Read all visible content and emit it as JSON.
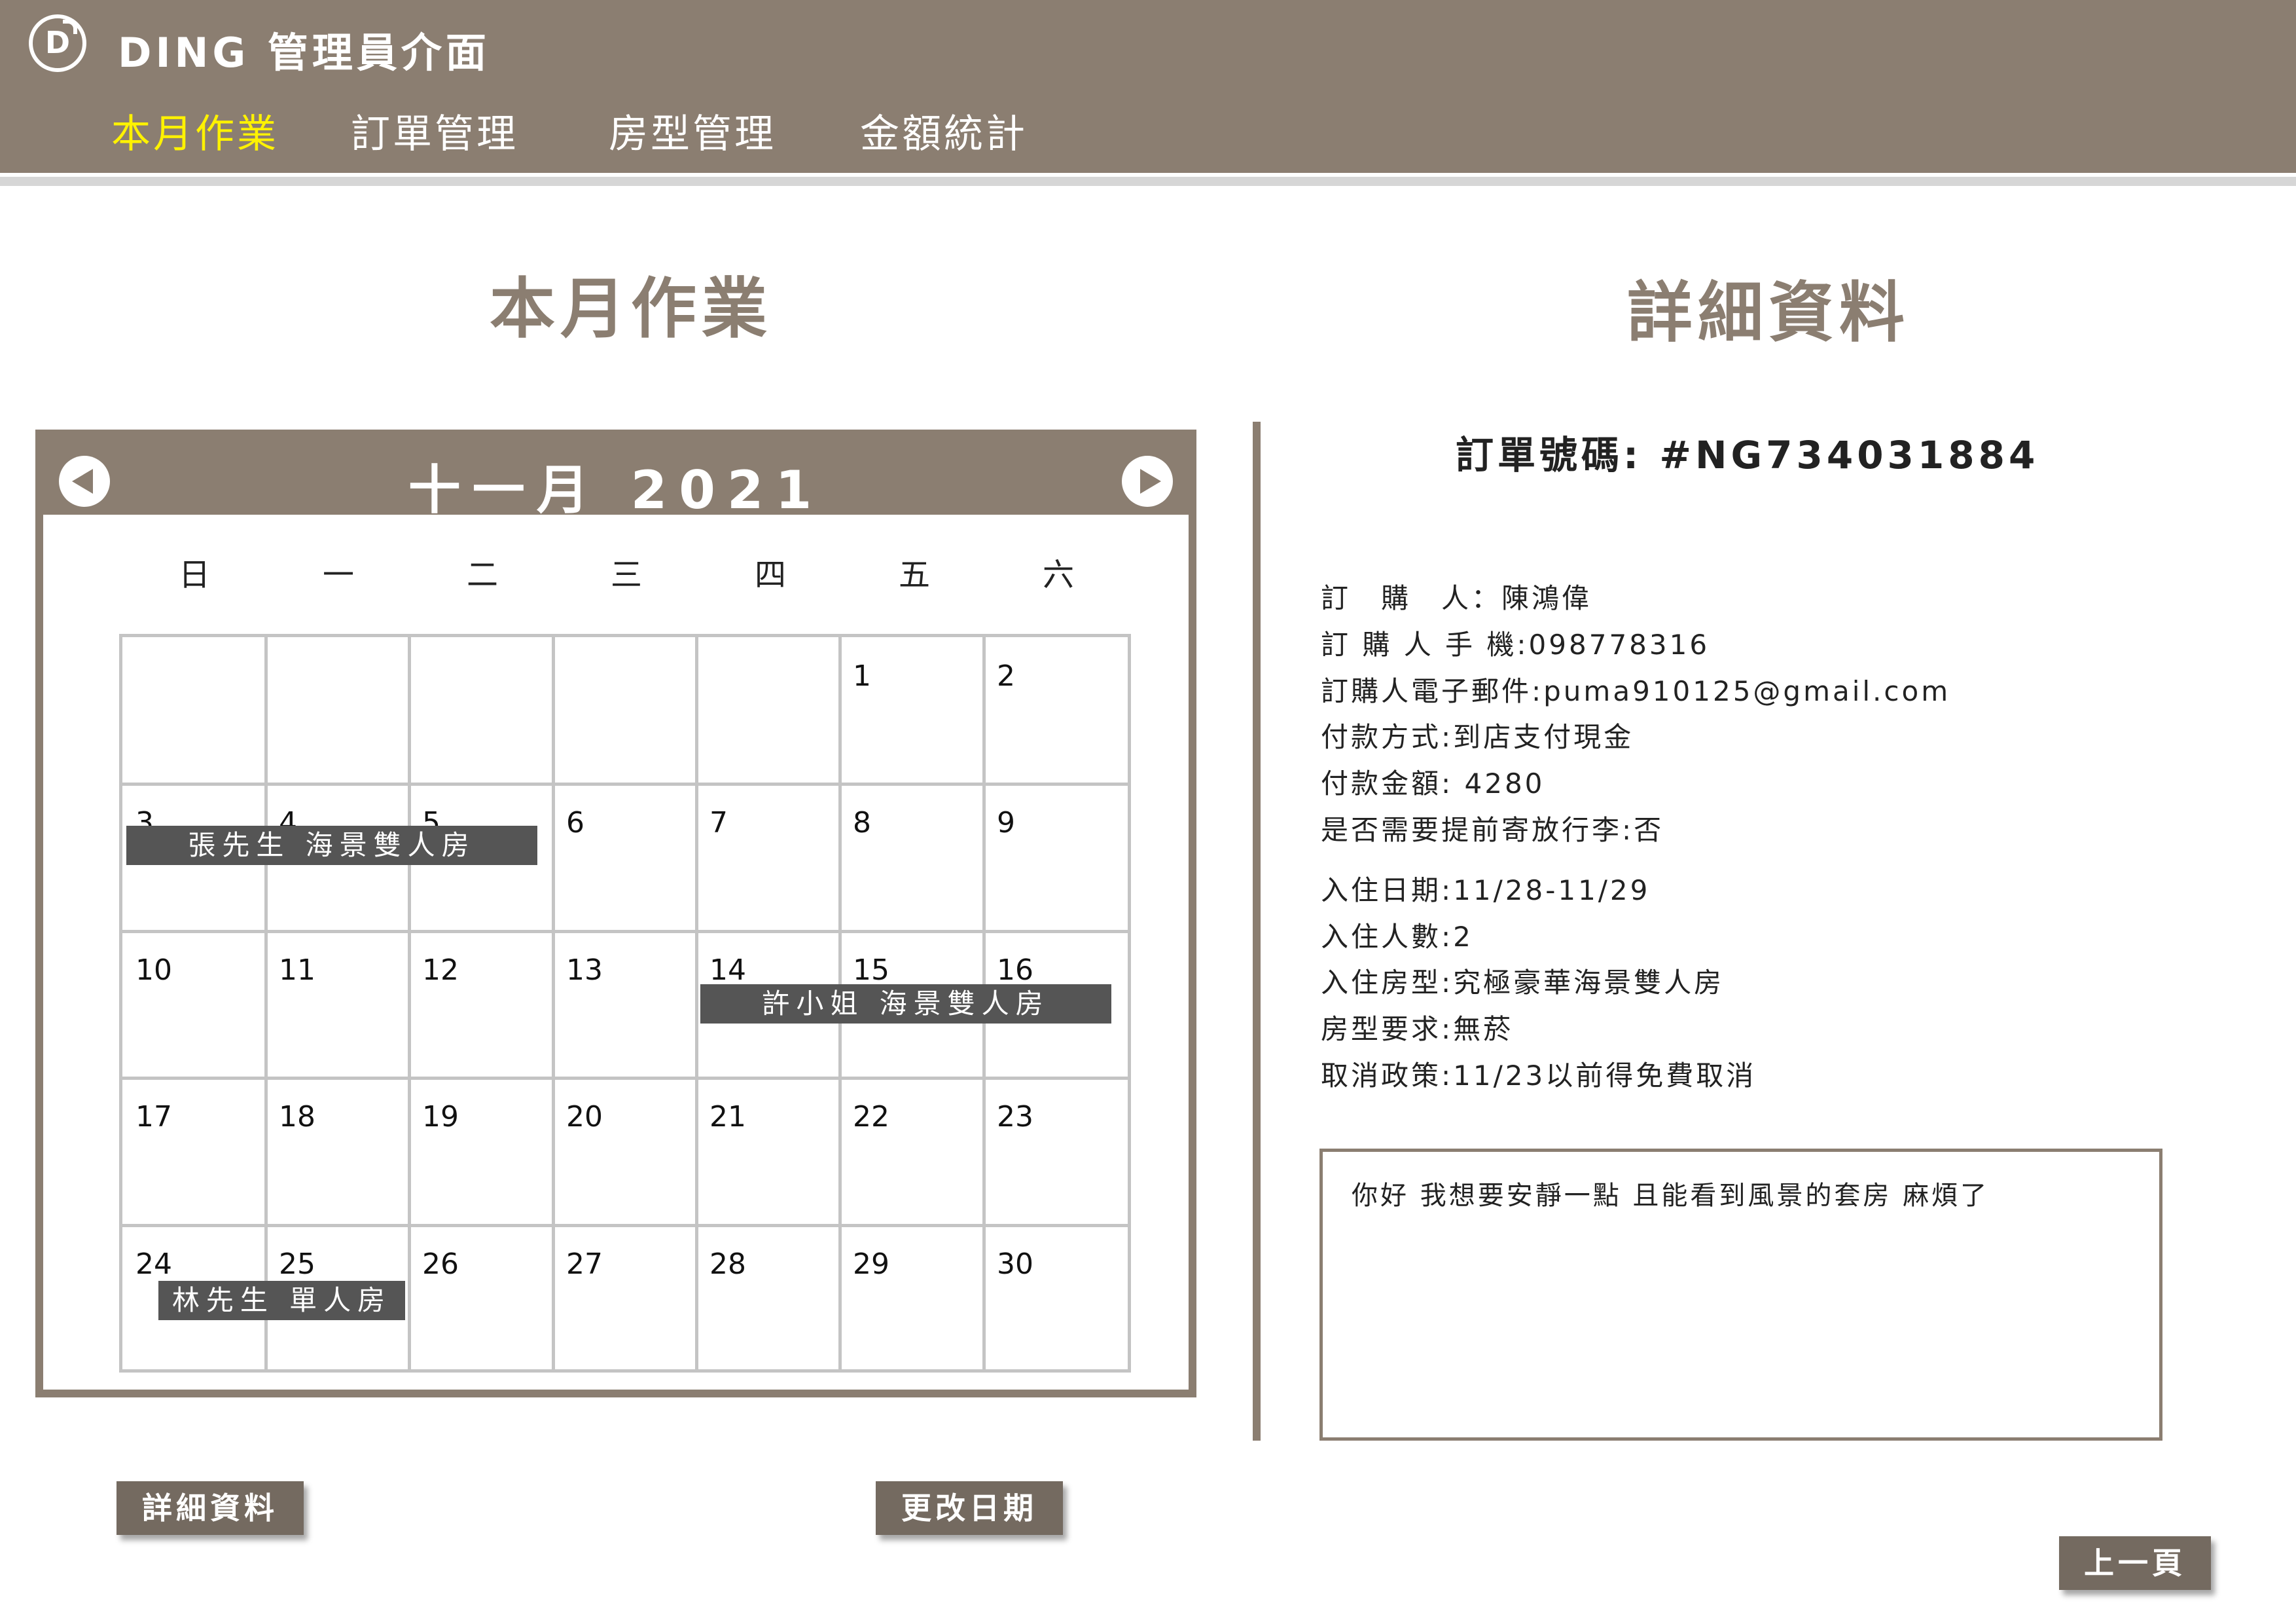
{
  "header": {
    "app_title": "DING 管理員介面",
    "logo_letter": "D",
    "nav": [
      {
        "label": "本月作業",
        "active": true
      },
      {
        "label": "訂單管理",
        "active": false
      },
      {
        "label": "房型管理",
        "active": false
      },
      {
        "label": "金額統計",
        "active": false
      }
    ]
  },
  "left": {
    "section_title": "本月作業",
    "calendar": {
      "month_label": "十一月 2021",
      "weekdays": [
        "日",
        "一",
        "二",
        "三",
        "四",
        "五",
        "六"
      ],
      "weeks": [
        [
          "",
          "",
          "",
          "",
          "",
          "1",
          "2"
        ],
        [
          "3",
          "4",
          "5",
          "6",
          "7",
          "8",
          "9"
        ],
        [
          "10",
          "11",
          "12",
          "13",
          "14",
          "15",
          "16"
        ],
        [
          "17",
          "18",
          "19",
          "20",
          "21",
          "22",
          "23"
        ],
        [
          "24",
          "25",
          "26",
          "27",
          "28",
          "29",
          "30"
        ]
      ],
      "events": [
        {
          "label": "張先生 海景雙人房"
        },
        {
          "label": "許小姐 海景雙人房"
        },
        {
          "label": "林先生 單人房"
        }
      ]
    },
    "buttons": {
      "detail": "詳細資料",
      "change_date": "更改日期"
    }
  },
  "right": {
    "section_title": "詳細資料",
    "order_number": "訂單號碼: #NG734031884",
    "info_lines": [
      "訂　購　人：陳鴻偉",
      "訂 購 人 手 機:098778316",
      "訂購人電子郵件:puma910125@gmail.com",
      "付款方式:到店支付現金",
      "付款金額: 4280",
      "是否需要提前寄放行李:否",
      "入住日期:11/28-11/29",
      "入住人數:2",
      "入住房型:究極豪華海景雙人房",
      "房型要求:無菸",
      "取消政策:11/23以前得免費取消"
    ],
    "note": "你好 我想要安靜一點 且能看到風景的套房 麻煩了",
    "back_button": "上一頁"
  },
  "colors": {
    "primary": "#8b7e71",
    "active_nav": "#fff200",
    "event_bg": "#555555",
    "button_bg": "#746a60"
  }
}
